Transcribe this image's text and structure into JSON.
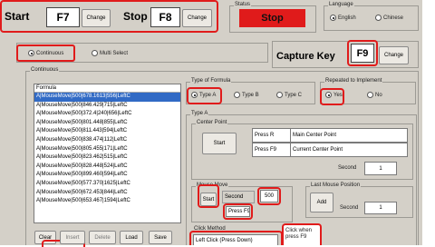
{
  "start": {
    "label": "Start",
    "key": "F7",
    "change": "Change"
  },
  "stop": {
    "label": "Stop",
    "key": "F8",
    "change": "Change"
  },
  "status": {
    "title": "Status",
    "value": "Stop"
  },
  "language": {
    "title": "Language",
    "english": "English",
    "chinese": "Chinese",
    "selected": "English"
  },
  "mode": {
    "continuous": "Continuous",
    "multi": "Multi Select",
    "selected": "Continuous"
  },
  "capture": {
    "label": "Capture Key",
    "key": "F9",
    "change": "Change"
  },
  "continuous_group": {
    "title": "Continuous"
  },
  "formula_list": {
    "header": "Formula",
    "items": [
      "A|MouseMove|500|678.1613|556|LeftC",
      "A|MouseMove|500|846.429|715|LeftC",
      "A|MouseMove|500|372.4|240|656|LeftC",
      "A|MouseMove|500|801.448|855|LeftC",
      "A|MouseMove|500|811.443|594|LeftC",
      "A|MouseMove|500|838.474|112|LeftC",
      "A|MouseMove|500|805.455|171|LeftC",
      "A|MouseMove|500|823.462|515|LeftC",
      "A|MouseMove|500|828.448|524|LeftC",
      "A|MouseMove|500|899.460|594|LeftC",
      "A|MouseMove|500|577.370|1625|LeftC",
      "A|MouseMove|500|672.453|844|LeftC",
      "A|MouseMove|500|653.467|1594|LeftC"
    ]
  },
  "list_buttons": {
    "clear": "Clear",
    "insert": "Insert",
    "delete": "Delete",
    "load": "Load",
    "save": "Save"
  },
  "type_of_formula": {
    "title": "Type of Formula",
    "a": "Type A",
    "b": "Type B",
    "c": "Type C",
    "selected": "Type A"
  },
  "repeated": {
    "title": "Repeated to Implement",
    "yes": "Yes",
    "no": "No",
    "selected": "Yes"
  },
  "type_a": {
    "title": "Type A",
    "center_point": {
      "title": "Center Point",
      "start": "Start",
      "press_r": "Press R",
      "main_center": "Main Center Point",
      "press_f9": "Press F9",
      "current_center": "Current Center Point",
      "second_label": "Second",
      "second_value": "1"
    },
    "mouse_move": {
      "title": "Mouse Move",
      "start": "Start",
      "second_label": "Second",
      "second_value": "500",
      "press_f9": "Press F9"
    },
    "last_mouse": {
      "title": "Last Mouse Position",
      "add": "Add",
      "second_label": "Second",
      "second_value": "1"
    },
    "click_method": {
      "title": "Click Method",
      "value": "Left Click (Press Down)"
    },
    "callout": "Click when press F9"
  },
  "colors": {
    "highlight": "#e01b1b",
    "status_bg": "#e01b1b",
    "selection": "#316ac5"
  }
}
